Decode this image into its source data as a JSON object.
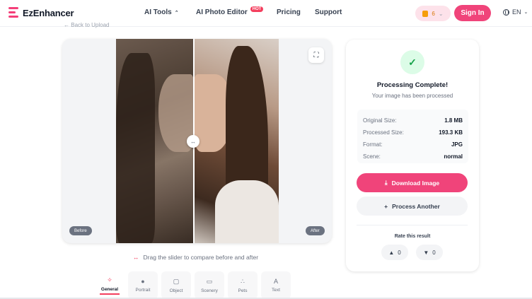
{
  "brand": {
    "name": "EzEnhancer",
    "accent": "#f0447a"
  },
  "nav": {
    "links": [
      "AI Tools",
      "AI Photo Editor",
      "Pricing",
      "Support"
    ],
    "hot_badge": "HOT",
    "credits": "6",
    "sign_in": "Sign In",
    "language": "EN"
  },
  "back_link": "Back to Upload",
  "compare": {
    "before_label": "Before",
    "after_label": "After",
    "hint": "Drag the slider to compare before and after"
  },
  "modes": [
    {
      "label": "General",
      "icon": "magic-wand-icon",
      "active": true
    },
    {
      "label": "Portrait",
      "icon": "person-icon",
      "active": false
    },
    {
      "label": "Object",
      "icon": "cube-icon",
      "active": false
    },
    {
      "label": "Scenery",
      "icon": "image-icon",
      "active": false
    },
    {
      "label": "Pets",
      "icon": "paw-icon",
      "active": false
    },
    {
      "label": "Text",
      "icon": "text-icon",
      "active": false
    }
  ],
  "result": {
    "title": "Processing Complete!",
    "subtitle": "Your image has been processed",
    "info": [
      {
        "key": "Original Size:",
        "value": "1.8 MB"
      },
      {
        "key": "Processed Size:",
        "value": "193.3 KB"
      },
      {
        "key": "Format:",
        "value": "JPG"
      },
      {
        "key": "Scene:",
        "value": "normal"
      }
    ],
    "download": "Download Image",
    "process_another": "Process Another",
    "rate_title": "Rate this result",
    "likes": "0",
    "dislikes": "0"
  }
}
